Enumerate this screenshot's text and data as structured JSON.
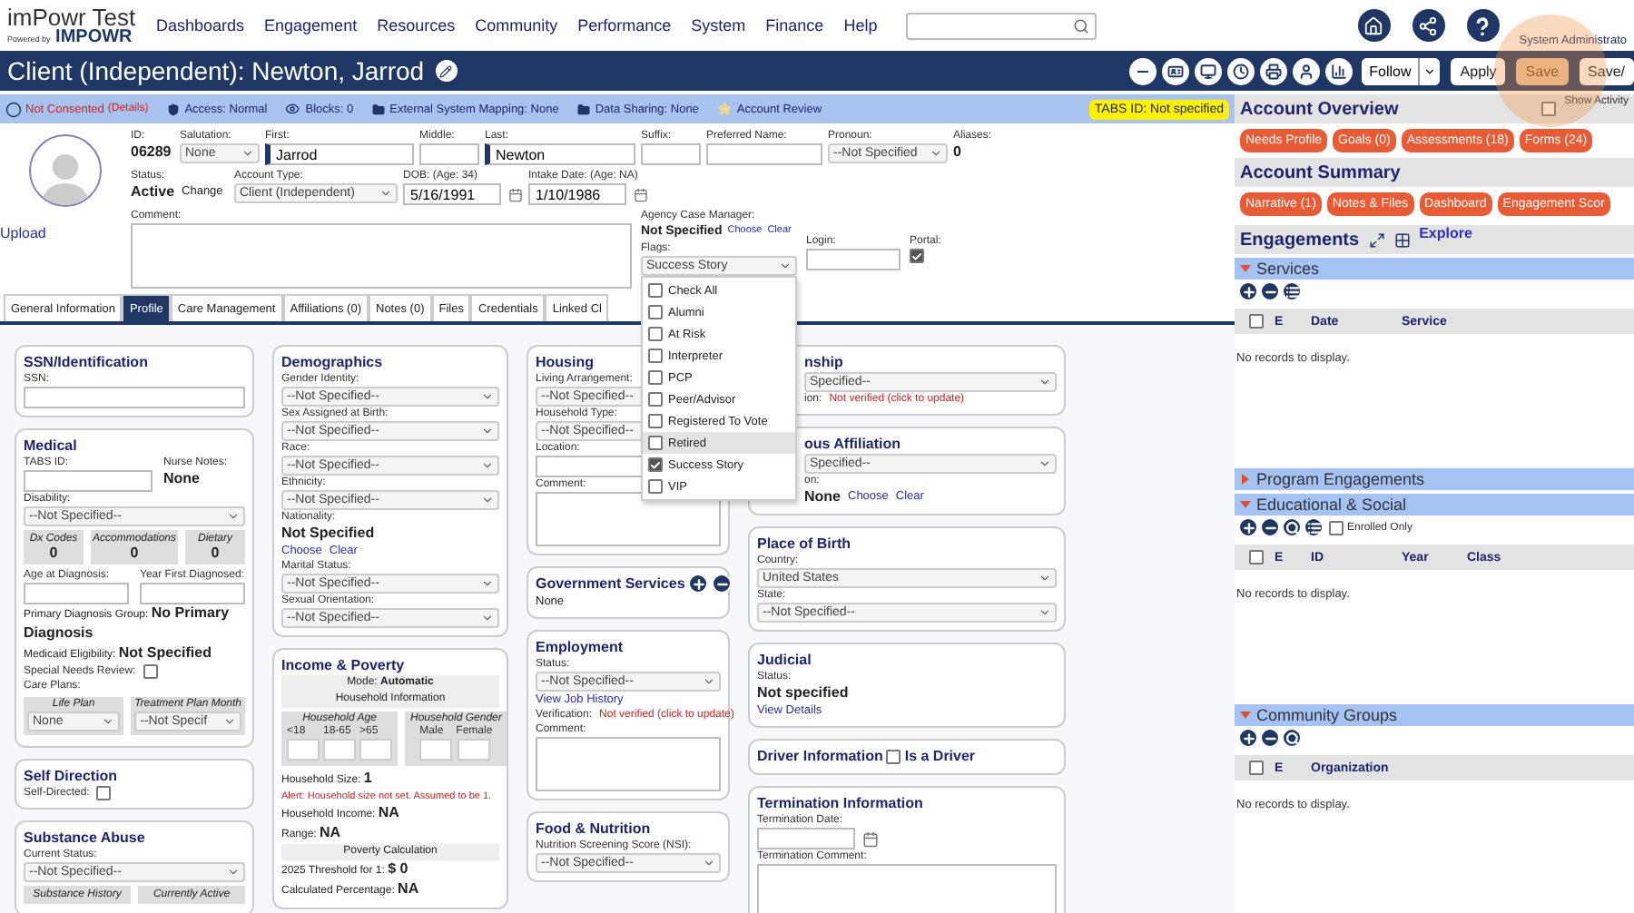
{
  "header": {
    "logo": {
      "title": "imPowr Test",
      "tagline": "Powered by",
      "brand": "IMPOWR"
    },
    "nav": [
      "Dashboards",
      "Engagement",
      "Resources",
      "Community",
      "Performance",
      "System",
      "Finance",
      "Help"
    ],
    "user_role": "System Administrato"
  },
  "title_bar": {
    "title": "Client (Independent): Newton, Jarrod",
    "follow": "Follow",
    "buttons": [
      {
        "label": "Apply",
        "disabled": false
      },
      {
        "label": "Save",
        "disabled": true
      },
      {
        "label": "Save/",
        "disabled": false
      }
    ]
  },
  "info_bar": {
    "consent": {
      "label": "Not Consented",
      "link": "(Details)"
    },
    "items": [
      {
        "kind": "access",
        "text": "Access: Normal"
      },
      {
        "kind": "blocks",
        "text": "Blocks: 0"
      },
      {
        "kind": "mapping",
        "text": "External System Mapping: None"
      },
      {
        "kind": "sharing",
        "text": "Data Sharing: None"
      },
      {
        "kind": "review",
        "text": "Account Review"
      }
    ],
    "badge": "TABS ID: Not specified"
  },
  "profile": {
    "upload": "Upload",
    "identity": [
      {
        "items": [
          {
            "kind": "label",
            "text": "ID:"
          },
          {
            "kind": "value",
            "text": "06289"
          }
        ]
      },
      {
        "items": [
          {
            "kind": "label",
            "text": "Salutation:"
          },
          {
            "kind": "select",
            "value": "None"
          }
        ]
      },
      {
        "items": [
          {
            "kind": "label",
            "text": "First:"
          },
          {
            "kind": "input",
            "value": "Jarrod",
            "required": true
          }
        ]
      },
      {
        "items": [
          {
            "kind": "label",
            "text": "Middle:"
          },
          {
            "kind": "input",
            "required": false
          }
        ]
      },
      {
        "items": [
          {
            "kind": "label",
            "text": "Last:"
          },
          {
            "kind": "input",
            "value": "Newton",
            "required": true
          }
        ]
      },
      {
        "items": [
          {
            "kind": "label",
            "text": "Suffix:"
          },
          {
            "kind": "input",
            "required": false
          }
        ]
      },
      {
        "items": [
          {
            "kind": "label",
            "text": "Preferred Name:"
          },
          {
            "kind": "input",
            "required": false
          }
        ]
      },
      {
        "items": [
          {
            "kind": "label",
            "text": "Pronoun:"
          },
          {
            "kind": "select",
            "value": "--Not Specified"
          }
        ]
      },
      {
        "items": [
          {
            "kind": "label",
            "text": "Aliases:"
          },
          {
            "kind": "value",
            "text": "0"
          }
        ]
      }
    ],
    "account": [
      {
        "items": [
          {
            "kind": "label",
            "text": "Status:"
          },
          {
            "kind": "status",
            "value": "Active",
            "action": "Change"
          }
        ]
      },
      {
        "items": [
          {
            "kind": "label",
            "text": "Account Type:"
          },
          {
            "kind": "select",
            "value": "Client (Independent)"
          }
        ]
      },
      {
        "items": [
          {
            "kind": "label",
            "text": "DOB: (Age: 34)"
          },
          {
            "kind": "date",
            "value": "5/16/1991"
          }
        ]
      },
      {
        "items": [
          {
            "kind": "label",
            "text": "Intake Date: (Age: NA)"
          },
          {
            "kind": "date",
            "value": "1/10/1986"
          }
        ]
      }
    ],
    "comment": {
      "label": "Comment:"
    },
    "manager": {
      "label": "Agency Case Manager:",
      "value": "Not Specified",
      "links": [
        "Choose",
        "Clear"
      ]
    },
    "flags": {
      "label": "Flags:",
      "value": "Success Story",
      "expanded": true,
      "options": [
        {
          "label": "Check All",
          "checked": false,
          "highlighted": false
        },
        {
          "label": "Alumni",
          "checked": false,
          "highlighted": false
        },
        {
          "label": "At Risk",
          "checked": false,
          "highlighted": false
        },
        {
          "label": "Interpreter",
          "checked": false,
          "highlighted": false
        },
        {
          "label": "PCP",
          "checked": false,
          "highlighted": false
        },
        {
          "label": "Peer/Advisor",
          "checked": false,
          "highlighted": false
        },
        {
          "label": "Registered To Vote",
          "checked": false,
          "highlighted": false
        },
        {
          "label": "Retired",
          "checked": false,
          "highlighted": true
        },
        {
          "label": "Success Story",
          "checked": true,
          "highlighted": false
        },
        {
          "label": "VIP",
          "checked": false,
          "highlighted": false
        }
      ]
    },
    "login": {
      "label": "Login:"
    },
    "portal": {
      "label": "Portal:",
      "checked": true
    }
  },
  "tabs": [
    {
      "label": "General Information",
      "selected": false
    },
    {
      "label": "Profile",
      "selected": true
    },
    {
      "label": "Care Management",
      "selected": false
    },
    {
      "label": "Affiliations (0)",
      "selected": false
    },
    {
      "label": "Notes (0)",
      "selected": false
    },
    {
      "label": "Files",
      "selected": false
    },
    {
      "label": "Credentials",
      "selected": false
    },
    {
      "label": "Linked Cl",
      "selected": false
    }
  ],
  "profile_tab": {
    "columns": [
      [
        {
          "title": "SSN/Identification",
          "fields": [
            {
              "kind": "label",
              "text": "SSN:"
            },
            {
              "kind": "input"
            }
          ]
        },
        {
          "title": "Medical",
          "fields": [
            {
              "kind": "split_row",
              "cols": [
                [
                  {
                    "kind": "label",
                    "text": "TABS ID:"
                  },
                  {
                    "kind": "input"
                  }
                ],
                [
                  {
                    "kind": "label",
                    "text": "Nurse Notes:"
                  },
                  {
                    "kind": "value",
                    "text": "None"
                  }
                ]
              ]
            },
            {
              "kind": "label",
              "text": "Disability:"
            },
            {
              "kind": "select",
              "value": "--Not Specified--"
            },
            {
              "kind": "stats",
              "items": [
                {
                  "label": "Dx Codes",
                  "value": "0"
                },
                {
                  "label": "Accommodations",
                  "value": "0"
                },
                {
                  "label": "Dietary",
                  "value": "0"
                }
              ]
            },
            {
              "kind": "row",
              "cols": [
                [
                  {
                    "kind": "label",
                    "text": "Age at Diagnosis:"
                  },
                  {
                    "kind": "input"
                  }
                ],
                [
                  {
                    "kind": "label",
                    "text": "Year First Diagnosed:"
                  },
                  {
                    "kind": "input"
                  }
                ]
              ]
            },
            {
              "kind": "lv",
              "label": "Primary Diagnosis Group:",
              "value": "No Primary Diagnosis"
            },
            {
              "kind": "lv",
              "label": "Medicaid Eligibility:",
              "value": "Not Specified"
            },
            {
              "kind": "check",
              "label": "Special Needs Review:",
              "checked": false
            },
            {
              "kind": "label",
              "text": "Care Plans:"
            },
            {
              "kind": "plans",
              "items": [
                {
                  "label": "Life Plan",
                  "value": "None"
                },
                {
                  "label": "Treatment Plan Month",
                  "value": "--Not Specif"
                }
              ]
            }
          ]
        },
        {
          "title": "Self Direction",
          "fields": [
            {
              "kind": "check",
              "label": "Self-Directed:",
              "checked": false
            }
          ]
        },
        {
          "title": "Substance Abuse",
          "fields": [
            {
              "kind": "label",
              "text": "Current Status:"
            },
            {
              "kind": "select",
              "value": "--Not Specified--"
            },
            {
              "kind": "stats",
              "items": [
                {
                  "label": "Substance History"
                },
                {
                  "label": "Currently Active"
                }
              ]
            }
          ]
        }
      ],
      [
        {
          "title": "Demographics",
          "fields": [
            {
              "kind": "label",
              "text": "Gender Identity:"
            },
            {
              "kind": "select",
              "value": "--Not Specified--"
            },
            {
              "kind": "label",
              "text": "Sex Assigned at Birth:"
            },
            {
              "kind": "select",
              "value": "--Not Specified--"
            },
            {
              "kind": "label",
              "text": "Race:"
            },
            {
              "kind": "select",
              "value": "--Not Specified--"
            },
            {
              "kind": "label",
              "text": "Ethnicity:"
            },
            {
              "kind": "select",
              "value": "--Not Specified--"
            },
            {
              "kind": "label",
              "text": "Nationality:"
            },
            {
              "kind": "value",
              "text": "Not Specified"
            },
            {
              "kind": "links",
              "items": [
                "Choose",
                "Clear"
              ]
            },
            {
              "kind": "label",
              "text": "Marital Status:"
            },
            {
              "kind": "select",
              "value": "--Not Specified--"
            },
            {
              "kind": "label",
              "text": "Sexual Orientation:"
            },
            {
              "kind": "select",
              "value": "--Not Specified--"
            }
          ]
        },
        {
          "title": "Income & Poverty",
          "fields": [
            {
              "kind": "band",
              "text": "Mode:",
              "value": "Automatic"
            },
            {
              "kind": "band",
              "text": "Household Information"
            },
            {
              "kind": "household",
              "groups": [
                {
                  "label": "Household Age",
                  "cols": [
                    "<18",
                    "18-65",
                    ">65"
                  ]
                },
                {
                  "label": "Household Gender",
                  "cols": [
                    "Male",
                    "Female"
                  ]
                }
              ]
            },
            {
              "kind": "lv",
              "label": "Household Size:",
              "value": "1"
            },
            {
              "kind": "alert",
              "text": "Alert: Household size not set. Assumed to be 1."
            },
            {
              "kind": "lv",
              "label": "Household Income:",
              "value": "NA"
            },
            {
              "kind": "lv",
              "label": "Range:",
              "value": "NA"
            },
            {
              "kind": "band",
              "text": "Poverty Calculation"
            },
            {
              "kind": "lv",
              "label": "2025 Threshold for 1:",
              "value": "$ 0"
            },
            {
              "kind": "lv",
              "label": "Calculated Percentage:",
              "value": "NA"
            }
          ]
        }
      ],
      [
        {
          "title": "Housing",
          "fields": [
            {
              "kind": "label",
              "text": "Living Arrangement:"
            },
            {
              "kind": "select",
              "value": "--Not Specified--"
            },
            {
              "kind": "label",
              "text": "Household Type:"
            },
            {
              "kind": "select",
              "value": "--Not Specified--"
            },
            {
              "kind": "label",
              "text": "Location:"
            },
            {
              "kind": "input"
            },
            {
              "kind": "label",
              "text": "Comment:"
            },
            {
              "kind": "textarea"
            }
          ]
        },
        {
          "title": "Government Services",
          "kind": "actions",
          "fields": [
            {
              "kind": "text",
              "text": "None"
            }
          ]
        },
        {
          "title": "Employment",
          "fields": [
            {
              "kind": "label",
              "text": "Status:"
            },
            {
              "kind": "select",
              "value": "--Not Specified--"
            },
            {
              "kind": "link",
              "text": "View Job History"
            },
            {
              "kind": "verify",
              "label": "Verification:",
              "value": "Not verified (click to update)"
            },
            {
              "kind": "label",
              "text": "Comment:"
            },
            {
              "kind": "textarea"
            }
          ]
        },
        {
          "title": "Food & Nutrition",
          "fields": [
            {
              "kind": "label",
              "text": "Nutrition Screening Score (NSI):"
            },
            {
              "kind": "select",
              "value": "--Not Specified--"
            }
          ]
        }
      ],
      [
        {
          "title": "nship",
          "fields": [
            {
              "kind": "select",
              "value": "Specified--"
            },
            {
              "kind": "verify",
              "label": "ion:",
              "value": "Not verified (click to update)"
            }
          ]
        },
        {
          "title": "ous Affiliation",
          "fields": [
            {
              "kind": "select",
              "value": "Specified--"
            },
            {
              "kind": "label",
              "text": "on:"
            },
            {
              "kind": "value_links",
              "value": "None",
              "links": [
                "Choose",
                "Clear"
              ]
            }
          ]
        },
        {
          "title": "Place of Birth",
          "fields": [
            {
              "kind": "label",
              "text": "Country:"
            },
            {
              "kind": "select",
              "value": "United States"
            },
            {
              "kind": "label",
              "text": "State:"
            },
            {
              "kind": "select",
              "value": "--Not Specified--"
            }
          ]
        },
        {
          "title": "Judicial",
          "fields": [
            {
              "kind": "label",
              "text": "Status:"
            },
            {
              "kind": "value",
              "text": "Not specified"
            },
            {
              "kind": "link",
              "text": "View Details"
            }
          ]
        },
        {
          "title": "Driver Information",
          "title_check": {
            "label": "Is a Driver",
            "checked": false
          }
        },
        {
          "title": "Termination Information",
          "fields": [
            {
              "kind": "label",
              "text": "Termination Date:"
            },
            {
              "kind": "date"
            },
            {
              "kind": "label",
              "text": "Termination Comment:"
            },
            {
              "kind": "textarea"
            }
          ]
        }
      ]
    ]
  },
  "account_overview": {
    "title": "Account Overview",
    "show_activity": {
      "label": "Show Activity",
      "checked": false
    },
    "pills": [
      "Needs Profile",
      "Goals (0)",
      "Assessments (18)",
      "Forms (24)"
    ]
  },
  "account_summary": {
    "title": "Account Summary",
    "pills": [
      "Narrative (1)",
      "Notes & Files",
      "Dashboard",
      "Engagement Scor"
    ]
  },
  "engagements": {
    "title": "Engagements",
    "explore": "Explore",
    "groups": [
      {
        "title": "Services",
        "expanded": true,
        "select_all": false,
        "columns": [
          "E",
          "Date",
          "Service"
        ],
        "empty": "No records to display."
      },
      {
        "title": "Program Engagements",
        "expanded": false
      },
      {
        "title": "Educational & Social",
        "expanded": true,
        "filter": {
          "label": "Enrolled Only",
          "checked": false
        },
        "select_all": false,
        "columns": [
          "E",
          "ID",
          "Year",
          "Class"
        ],
        "empty": "No records to display."
      },
      {
        "title": "Community Groups",
        "expanded": true,
        "select_all": false,
        "columns": [
          "E",
          "Organization"
        ],
        "empty": "No records to display."
      }
    ]
  }
}
